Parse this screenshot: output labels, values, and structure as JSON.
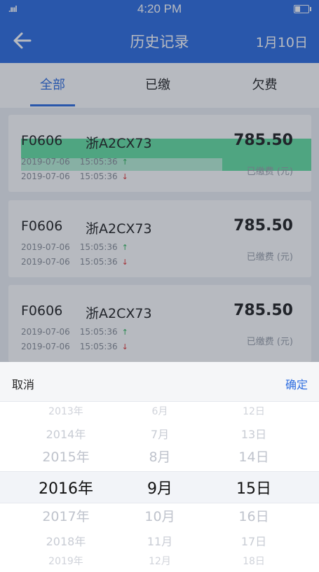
{
  "status_bar": {
    "signal": ".ıııl",
    "time": "4:20 PM"
  },
  "nav": {
    "title": "历史记录",
    "date": "1月10日",
    "back_icon": "arrow-left-icon"
  },
  "tabs": [
    {
      "label": "全部",
      "active": true
    },
    {
      "label": "已缴",
      "active": false
    },
    {
      "label": "欠费",
      "active": false
    }
  ],
  "records": [
    {
      "code": "F0606",
      "plate": "浙A2CX73",
      "amount": "785.50",
      "status": "已缴费 (元)",
      "times": [
        {
          "date": "2019-07-06",
          "time": "15:05:36",
          "arrow": "↑"
        },
        {
          "date": "2019-07-06",
          "time": "15:05:36",
          "arrow": "↓"
        }
      ]
    },
    {
      "code": "F0606",
      "plate": "浙A2CX73",
      "amount": "785.50",
      "status": "已缴费 (元)",
      "times": [
        {
          "date": "2019-07-06",
          "time": "15:05:36",
          "arrow": "↑"
        },
        {
          "date": "2019-07-06",
          "time": "15:05:36",
          "arrow": "↓"
        }
      ]
    },
    {
      "code": "F0606",
      "plate": "浙A2CX73",
      "amount": "785.50",
      "status": "已缴费 (元)",
      "times": [
        {
          "date": "2019-07-06",
          "time": "15:05:36",
          "arrow": "↑"
        },
        {
          "date": "2019-07-06",
          "time": "15:05:36",
          "arrow": "↓"
        }
      ]
    }
  ],
  "picker": {
    "cancel": "取消",
    "confirm": "确定",
    "years": [
      "2013年",
      "2014年",
      "2015年",
      "2016年",
      "2017年",
      "2018年",
      "2019年"
    ],
    "months": [
      "6月",
      "7月",
      "8月",
      "9月",
      "10月",
      "11月",
      "12月"
    ],
    "days": [
      "12日",
      "13日",
      "14日",
      "15日",
      "16日",
      "17日",
      "18日"
    ],
    "selected": {
      "year": "2016年",
      "month": "9月",
      "day": "15日"
    }
  },
  "colors": {
    "primary": "#2f6ee0",
    "up": "#2fb55a",
    "down": "#e03535",
    "highlight": "#66e0a2"
  }
}
